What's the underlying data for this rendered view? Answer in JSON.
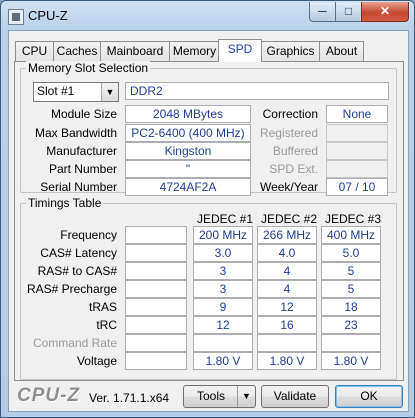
{
  "window": {
    "title": "CPU-Z",
    "minimize": "─",
    "maximize": "□",
    "close": "✕"
  },
  "tabs": [
    "CPU",
    "Caches",
    "Mainboard",
    "Memory",
    "SPD",
    "Graphics",
    "About"
  ],
  "active_tab": "SPD",
  "slot_group": {
    "title": "Memory Slot Selection",
    "slot_select": "Slot #1",
    "memory_type": "DDR2",
    "module_size": {
      "label": "Module Size",
      "value": "2048 MBytes"
    },
    "max_bandwidth": {
      "label": "Max Bandwidth",
      "value": "PC2-6400 (400 MHz)"
    },
    "manufacturer": {
      "label": "Manufacturer",
      "value": "Kingston"
    },
    "part_number": {
      "label": "Part Number",
      "value": "\""
    },
    "serial_number": {
      "label": "Serial Number",
      "value": "4724AF2A"
    },
    "correction": {
      "label": "Correction",
      "value": "None"
    },
    "registered": {
      "label": "Registered",
      "value": ""
    },
    "buffered": {
      "label": "Buffered",
      "value": ""
    },
    "spd_ext": {
      "label": "SPD Ext.",
      "value": ""
    },
    "week_year": {
      "label": "Week/Year",
      "value": "07 / 10"
    }
  },
  "timings": {
    "title": "Timings Table",
    "columns": [
      "JEDEC #1",
      "JEDEC #2",
      "JEDEC #3"
    ],
    "rows": [
      {
        "label": "Frequency",
        "values": [
          "200 MHz",
          "266 MHz",
          "400 MHz"
        ],
        "dim": false
      },
      {
        "label": "CAS# Latency",
        "values": [
          "3.0",
          "4.0",
          "5.0"
        ],
        "dim": false
      },
      {
        "label": "RAS# to CAS#",
        "values": [
          "3",
          "4",
          "5"
        ],
        "dim": false
      },
      {
        "label": "RAS# Precharge",
        "values": [
          "3",
          "4",
          "5"
        ],
        "dim": false
      },
      {
        "label": "tRAS",
        "values": [
          "9",
          "12",
          "18"
        ],
        "dim": false
      },
      {
        "label": "tRC",
        "values": [
          "12",
          "16",
          "23"
        ],
        "dim": false
      },
      {
        "label": "Command Rate",
        "values": [
          "",
          "",
          ""
        ],
        "dim": true
      },
      {
        "label": "Voltage",
        "values": [
          "1.80 V",
          "1.80 V",
          "1.80 V"
        ],
        "dim": false
      }
    ]
  },
  "footer": {
    "logo": "CPU-Z",
    "version": "Ver. 1.71.1.x64",
    "tools_label": "Tools",
    "validate_label": "Validate",
    "ok_label": "OK"
  }
}
